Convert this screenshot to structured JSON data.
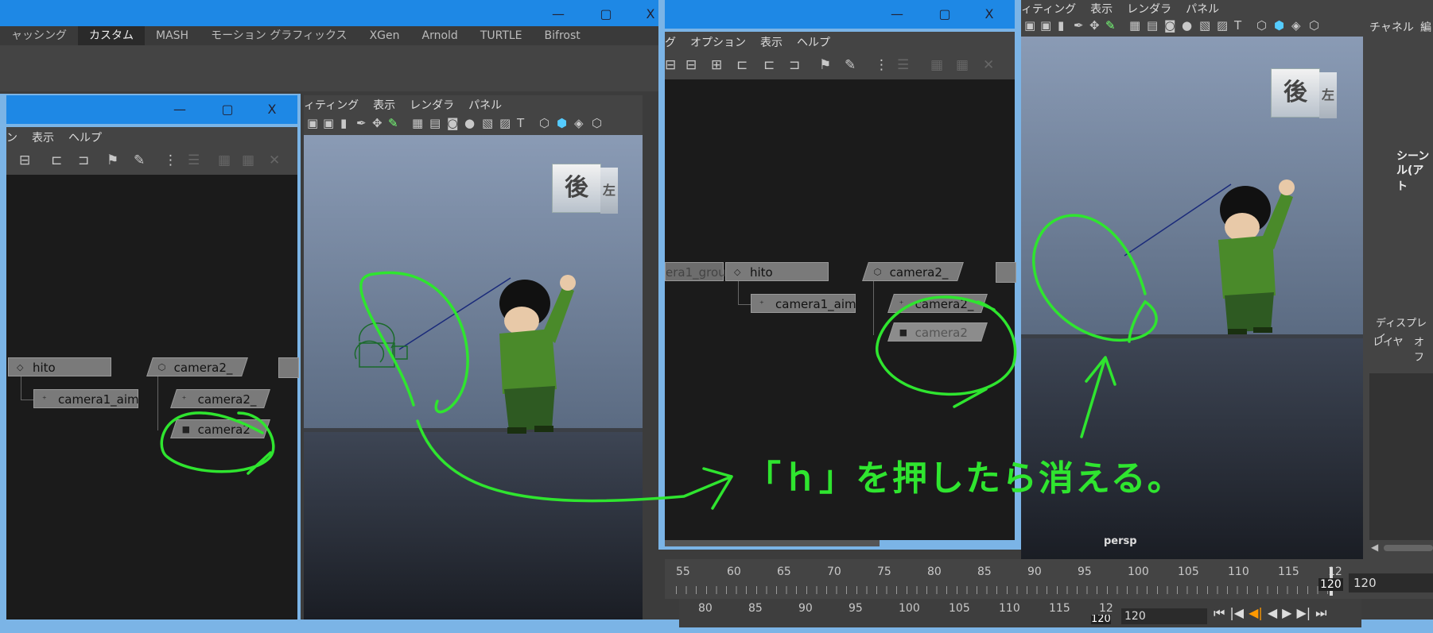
{
  "main_window": {
    "shelf_tabs": [
      "ャッシング",
      "カスタム",
      "MASH",
      "モーション グラフィックス",
      "XGen",
      "Arnold",
      "TURTLE",
      "Bifrost"
    ],
    "active_tab": "カスタム"
  },
  "window_buttons": {
    "minimize": "—",
    "maximize": "▢",
    "close": "X"
  },
  "left_outliner": {
    "menu": [
      "ン",
      "表示",
      "ヘルプ"
    ],
    "nodes": {
      "hito": "hito",
      "camera2_group": "camera2_",
      "camera1_aim": "camera1_aim",
      "camera2_aim": "camera2_",
      "camera2": "camera2"
    }
  },
  "left_viewport": {
    "menu": [
      "ィティング",
      "表示",
      "レンダラ",
      "パネル"
    ],
    "viewcube_label": "後",
    "viewcube_side": "左"
  },
  "right_outliner": {
    "menu": [
      "グ",
      "オプション",
      "表示",
      "ヘルプ"
    ],
    "nodes": {
      "camera1_group": "era1_grou",
      "hito": "hito",
      "camera2_group": "camera2_",
      "camera1_aim": "camera1_aim",
      "camera2_aim": "camera2_",
      "camera2": "camera2"
    }
  },
  "right_viewport": {
    "menu": [
      "ィティング",
      "表示",
      "レンダラ",
      "パネル"
    ],
    "viewcube_label": "後",
    "viewcube_side": "左",
    "camera_label": "persp"
  },
  "channel_box": {
    "title": "チャネル",
    "title_cut": "編",
    "scene_text_1": "シーン",
    "scene_text_2": "ル(アト",
    "display_tab": "ディスプレイ",
    "layer_label": "レイヤ",
    "option_label": "オフ"
  },
  "timeline_upper": {
    "ticks": [
      "55",
      "60",
      "65",
      "70",
      "75",
      "80",
      "85",
      "90",
      "95",
      "100",
      "105",
      "110",
      "115",
      "12"
    ],
    "current_frame": "120",
    "end_field": "120"
  },
  "timeline_lower": {
    "ticks": [
      "80",
      "85",
      "90",
      "95",
      "100",
      "105",
      "110",
      "115",
      "12"
    ],
    "end_field": "120",
    "frame_cut": "120"
  },
  "playback": [
    "⏮",
    "|◀",
    "◀|",
    "◀",
    "▶",
    "▶|",
    "⏭"
  ],
  "annotation": {
    "text": "「ｈ」を押したら消える。",
    "color": "#2fe52f"
  },
  "colors": {
    "titlebar": "#1e88e5",
    "window_frame": "#7bb4e6",
    "outliner_bg": "#1b1b1b"
  }
}
